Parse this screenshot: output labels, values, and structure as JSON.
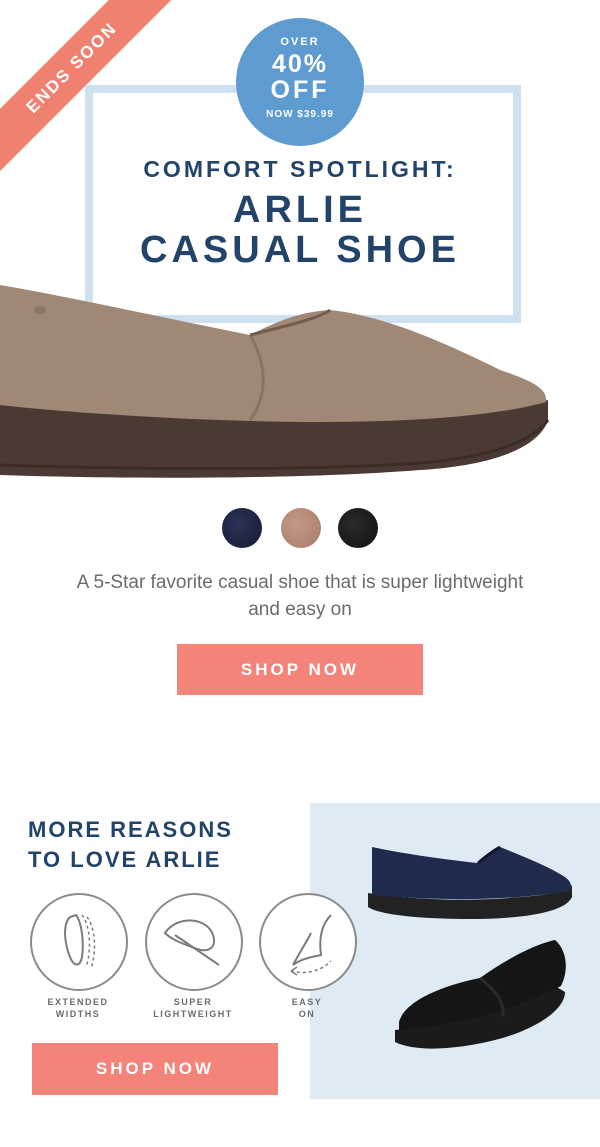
{
  "ribbon": {
    "text": "ENDS SOON"
  },
  "badge": {
    "over": "OVER",
    "percent": "40%",
    "off": "OFF",
    "price": "NOW $39.99"
  },
  "hero": {
    "kicker": "COMFORT SPOTLIGHT:",
    "title_line1": "ARLIE",
    "title_line2": "CASUAL SHOE",
    "description": "A 5-Star favorite casual shoe that is super lightweight and easy on",
    "cta": "SHOP NOW"
  },
  "swatches": [
    {
      "name": "navy",
      "color": "#1e2547"
    },
    {
      "name": "taupe",
      "color": "#b48b76"
    },
    {
      "name": "black",
      "color": "#1a1a1a"
    }
  ],
  "reasons": {
    "title_line1": "MORE REASONS",
    "title_line2": "TO LOVE ARLIE",
    "features": [
      {
        "line1": "EXTENDED",
        "line2": "WIDTHS",
        "icon": "insole-icon"
      },
      {
        "line1": "SUPER",
        "line2": "LIGHTWEIGHT",
        "icon": "feather-icon"
      },
      {
        "line1": "EASY",
        "line2": "ON",
        "icon": "foot-slip-on-icon"
      }
    ],
    "cta": "SHOP NOW"
  },
  "colors": {
    "accent": "#f4837a",
    "navy_text": "#23446a",
    "badge_blue": "#5e9bd0",
    "panel_blue": "#deebf5"
  }
}
